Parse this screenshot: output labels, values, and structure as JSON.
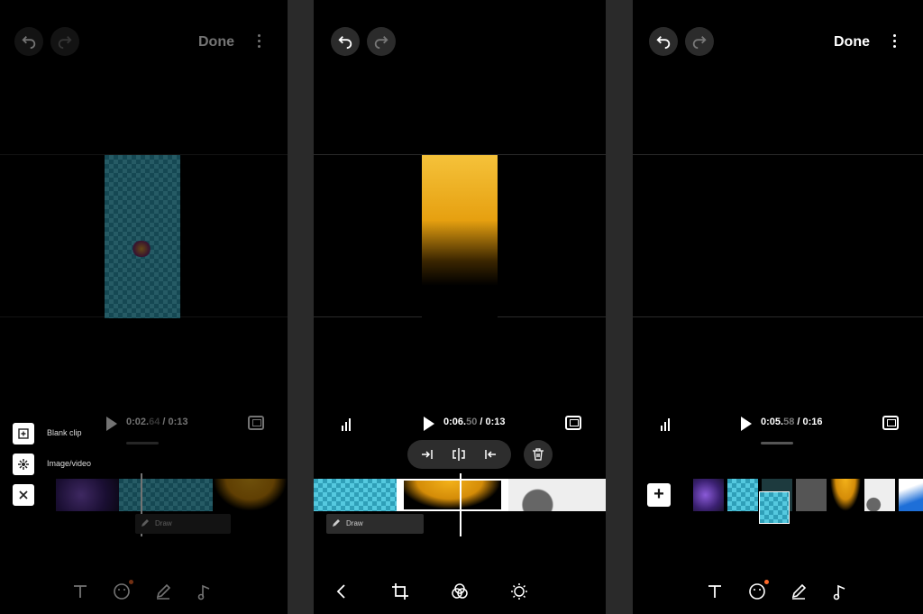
{
  "panel1": {
    "done_label": "Done",
    "time_current_main": "0:02.",
    "time_current_frac": "64",
    "time_total": " / 0:13",
    "menu": [
      {
        "icon": "blank-clip-icon",
        "label": "Blank clip"
      },
      {
        "icon": "image-video-icon",
        "label": "Image/video"
      },
      {
        "icon": "close-icon",
        "label": ""
      }
    ],
    "draw_label": "Draw",
    "badge_color": "#ff6a2a"
  },
  "panel2": {
    "time_current_main": "0:06.",
    "time_current_frac": "50",
    "time_total": " / 0:13",
    "draw_label": "Draw",
    "tools": [
      "trim-start-icon",
      "split-icon",
      "trim-end-icon",
      "delete-icon"
    ],
    "bottom_tools": [
      "back-icon",
      "crop-icon",
      "filter-icon",
      "adjust-icon"
    ]
  },
  "panel3": {
    "done_label": "Done",
    "time_current_main": "0:05.",
    "time_current_frac": "58",
    "time_total": " / 0:16",
    "add_label": "+",
    "bottom_tools": [
      "text-icon",
      "sticker-icon",
      "draw-icon",
      "music-icon"
    ]
  },
  "colors": {
    "accent_dot": "#ff6a2a",
    "clip_blue": "#55c9df",
    "clip_yellow": "#f4b21a"
  }
}
